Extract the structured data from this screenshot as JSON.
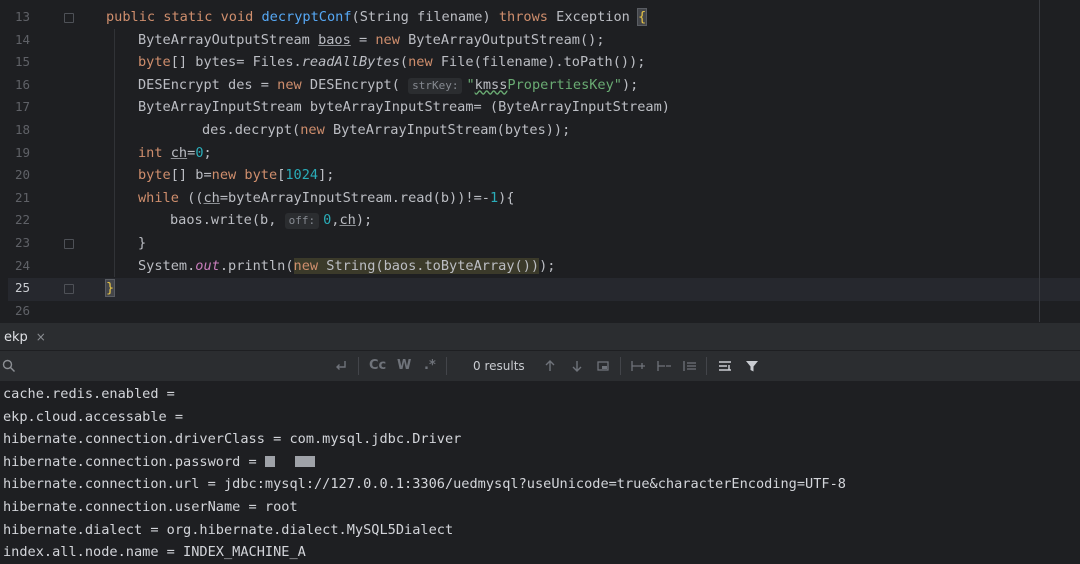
{
  "editor": {
    "line_numbers": [
      "13",
      "14",
      "15",
      "16",
      "17",
      "18",
      "19",
      "20",
      "21",
      "22",
      "23",
      "24",
      "25",
      "26"
    ],
    "lines": [
      [
        {
          "t": "public static void ",
          "c": "kw"
        },
        {
          "t": "decryptConf",
          "c": "fn"
        },
        {
          "t": "(String filename) "
        },
        {
          "t": "throws",
          "c": "kw"
        },
        {
          "t": " Exception "
        },
        {
          "t": "{",
          "c": "brace"
        }
      ],
      [
        {
          "t": "ByteArrayOutputStream "
        },
        {
          "t": "baos",
          "c": "ul"
        },
        {
          "t": " = "
        },
        {
          "t": "new",
          "c": "kw"
        },
        {
          "t": " ByteArrayOutputStream();"
        }
      ],
      [
        {
          "t": "byte",
          "c": "kw"
        },
        {
          "t": "[] bytes= Files."
        },
        {
          "t": "readAllBytes",
          "c": "it"
        },
        {
          "t": "("
        },
        {
          "t": "new",
          "c": "kw"
        },
        {
          "t": " File(filename).toPath());"
        }
      ],
      [
        {
          "t": "DESEncrypt des = "
        },
        {
          "t": "new",
          "c": "kw"
        },
        {
          "t": " DESEncrypt( "
        },
        {
          "t": "strKey:",
          "c": "hint"
        },
        {
          "t": "\"",
          "c": "str"
        },
        {
          "t": "kmss",
          "c": "sq"
        },
        {
          "t": "PropertiesKey\"",
          "c": "str"
        },
        {
          "t": ");"
        }
      ],
      [
        {
          "t": "ByteArrayInputStream byteArrayInputStream= (ByteArrayInputStream)"
        }
      ],
      [
        {
          "t": "des.decrypt("
        },
        {
          "t": "new",
          "c": "kw"
        },
        {
          "t": " ByteArrayInputStream(bytes));"
        }
      ],
      [
        {
          "t": "int",
          "c": "kw"
        },
        {
          "t": " "
        },
        {
          "t": "ch",
          "c": "ul"
        },
        {
          "t": "="
        },
        {
          "t": "0",
          "c": "num"
        },
        {
          "t": ";"
        }
      ],
      [
        {
          "t": "byte",
          "c": "kw"
        },
        {
          "t": "[] b="
        },
        {
          "t": "new",
          "c": "kw"
        },
        {
          "t": " "
        },
        {
          "t": "byte",
          "c": "kw"
        },
        {
          "t": "["
        },
        {
          "t": "1024",
          "c": "num"
        },
        {
          "t": "];"
        }
      ],
      [
        {
          "t": "while",
          "c": "kw"
        },
        {
          "t": " (("
        },
        {
          "t": "ch",
          "c": "ul"
        },
        {
          "t": "=byteArrayInputStream.read(b))!=-"
        },
        {
          "t": "1",
          "c": "num"
        },
        {
          "t": "){"
        }
      ],
      [
        {
          "t": "baos.write(b, "
        },
        {
          "t": "off:",
          "c": "hint"
        },
        {
          "t": "0",
          "c": "num"
        },
        {
          "t": ","
        },
        {
          "t": "ch",
          "c": "ul"
        },
        {
          "t": ");"
        }
      ],
      [
        {
          "t": "}"
        }
      ],
      [
        {
          "t": "System."
        },
        {
          "t": "out",
          "c": "st"
        },
        {
          "t": ".println("
        },
        {
          "t": "new",
          "c": "kw hl"
        },
        {
          "t": " String(baos.toByteArray())",
          "c": "hl"
        },
        {
          "t": ");"
        }
      ],
      [
        {
          "t": "}",
          "c": "brace"
        }
      ],
      []
    ]
  },
  "run_panel": {
    "tab_label": "ekp",
    "tab_close": "×"
  },
  "find_bar": {
    "results_label": "0 results",
    "match_case": "Cc",
    "whole_word": "W",
    "regex": ".*"
  },
  "console": {
    "lines": [
      "cache.redis.enabled =",
      "ekp.cloud.accessable =",
      "hibernate.connection.driverClass = com.mysql.jdbc.Driver",
      "hibernate.connection.password = ",
      "hibernate.connection.url = jdbc:mysql://127.0.0.1:3306/uedmysql?useUnicode=true&characterEncoding=UTF-8",
      "hibernate.connection.userName = root",
      "hibernate.dialect = org.hibernate.dialect.MySQL5Dialect",
      "index.all.node.name = INDEX_MACHINE_A"
    ]
  },
  "colors": {
    "accent": "#3574f0",
    "keyword": "#cf8e6d",
    "function": "#56a8f5",
    "number": "#2aacb8",
    "string": "#6aab73"
  }
}
